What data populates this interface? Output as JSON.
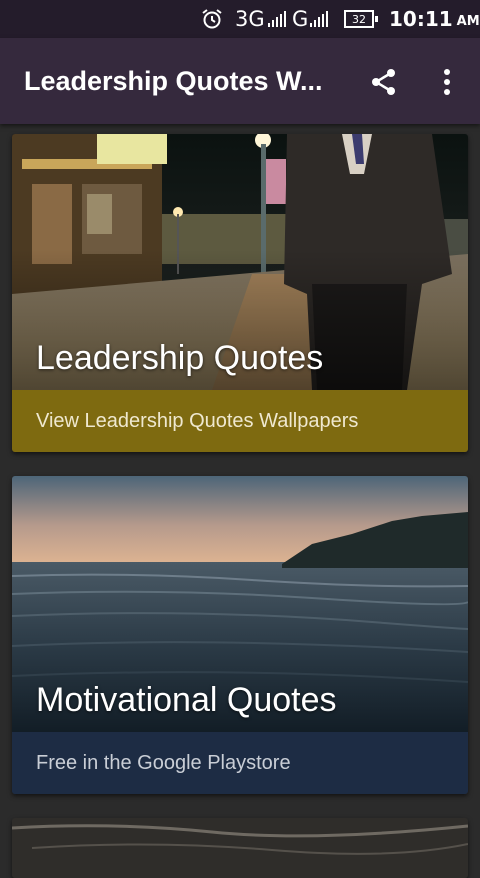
{
  "status_bar": {
    "network_1": "3G",
    "network_2": "G",
    "battery": "32",
    "time": "10:11",
    "ampm": "AM",
    "icons": [
      "alarm-icon",
      "signal-icon",
      "signal-icon",
      "battery-icon"
    ]
  },
  "app_bar": {
    "title": "Leadership Quotes W...",
    "icons": [
      "share-icon",
      "more-vert-icon"
    ]
  },
  "cards": [
    {
      "title": "Leadership Quotes",
      "subtitle": "View Leadership Quotes Wallpapers",
      "footer_color": "#7e6a10"
    },
    {
      "title": "Motivational Quotes",
      "subtitle": "Free in the Google Playstore",
      "footer_color": "#1d2c44"
    }
  ],
  "colors": {
    "status_bar": "#241c2b",
    "app_bar": "#35293d",
    "background": "#2b2b2b"
  }
}
